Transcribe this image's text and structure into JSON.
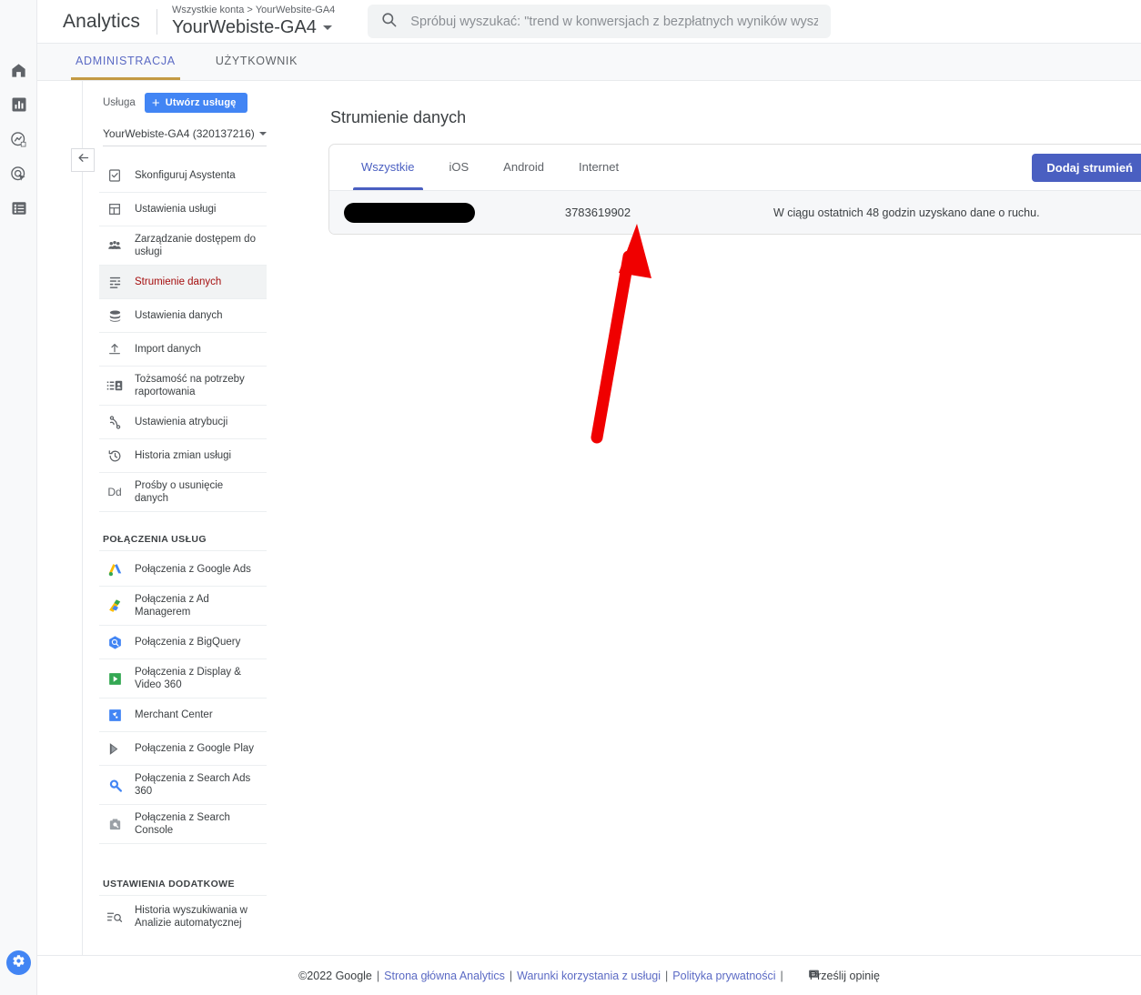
{
  "brand": {
    "name": "Analytics",
    "logo_icon": "analytics-bars-logo"
  },
  "account": {
    "breadcrumb_root": "Wszystkie konta",
    "breadcrumb_sep": ">",
    "breadcrumb_current": "YourWebsite-GA4",
    "property_name": "YourWebiste-GA4"
  },
  "search": {
    "placeholder": "Spróbuj wyszukać: \"trend w konwersjach z bezpłatnych wyników wyszuki…",
    "icon": "search-icon"
  },
  "rail": {
    "items": [
      {
        "name": "home",
        "icon": "home-icon"
      },
      {
        "name": "reports",
        "icon": "bar-chart-icon"
      },
      {
        "name": "explore",
        "icon": "explore-compass-icon"
      },
      {
        "name": "advertising",
        "icon": "advertising-target-icon"
      },
      {
        "name": "library",
        "icon": "library-list-icon"
      }
    ],
    "admin_icon": "gear-icon"
  },
  "tabs": [
    {
      "label": "ADMINISTRACJA",
      "active": true
    },
    {
      "label": "UŻYTKOWNIK",
      "active": false
    }
  ],
  "back_button": {
    "icon": "arrow-left-icon"
  },
  "sidebar": {
    "property_label": "Usługa",
    "create_button": {
      "label": "Utwórz usługę",
      "icon": "plus-icon"
    },
    "property_selector": {
      "value": "YourWebiste-GA4 (320137216)",
      "icon": "chevron-down-icon"
    },
    "items": [
      {
        "label": "Skonfiguruj Asystenta",
        "icon": "checklist-icon",
        "selected": false
      },
      {
        "label": "Ustawienia usługi",
        "icon": "property-settings-icon",
        "selected": false
      },
      {
        "label": "Zarządzanie dostępem do usługi",
        "icon": "people-icon",
        "selected": false
      },
      {
        "label": "Strumienie danych",
        "icon": "data-streams-icon",
        "selected": true
      },
      {
        "label": "Ustawienia danych",
        "icon": "database-icon",
        "selected": false
      },
      {
        "label": "Import danych",
        "icon": "upload-icon",
        "selected": false
      },
      {
        "label": "Tożsamość na potrzeby raportowania",
        "icon": "reporting-identity-icon",
        "selected": false
      },
      {
        "label": "Ustawienia atrybucji",
        "icon": "attribution-icon",
        "selected": false
      },
      {
        "label": "Historia zmian usługi",
        "icon": "history-clock-icon",
        "selected": false
      },
      {
        "label": "Prośby o usunięcie danych",
        "icon": "dd-text-icon",
        "selected": false
      }
    ],
    "section_links_title": "POŁĄCZENIA USŁUG",
    "link_items": [
      {
        "label": "Połączenia z Google Ads",
        "icon": "google-ads-icon"
      },
      {
        "label": "Połączenia z Ad Managerem",
        "icon": "ad-manager-icon"
      },
      {
        "label": "Połączenia z BigQuery",
        "icon": "bigquery-icon"
      },
      {
        "label": "Połączenia z Display & Video 360",
        "icon": "display-video-360-icon"
      },
      {
        "label": "Merchant Center",
        "icon": "merchant-center-icon"
      },
      {
        "label": "Połączenia z Google Play",
        "icon": "google-play-icon"
      },
      {
        "label": "Połączenia z Search Ads 360",
        "icon": "search-ads-360-icon"
      },
      {
        "label": "Połączenia z Search Console",
        "icon": "search-console-icon"
      }
    ],
    "section_extra_title": "USTAWIENIA DODATKOWE",
    "extra_items": [
      {
        "label": "Historia wyszukiwania w Analizie automatycznej",
        "icon": "search-history-icon"
      }
    ]
  },
  "main": {
    "page_title": "Strumienie danych",
    "card_tabs": [
      {
        "label": "Wszystkie",
        "active": true
      },
      {
        "label": "iOS",
        "active": false
      },
      {
        "label": "Android",
        "active": false
      },
      {
        "label": "Internet",
        "active": false
      }
    ],
    "add_stream_button": {
      "label": "Dodaj strumień",
      "icon": "chevron-down-icon"
    },
    "stream_row": {
      "name_redacted": true,
      "stream_id": "3783619902",
      "status": "W ciągu ostatnich 48 godzin uzyskano dane o ruchu.",
      "chevron_icon": "chevron-right-icon"
    }
  },
  "annotation": {
    "type": "red-arrow",
    "color": "#f00000"
  },
  "footer": {
    "copyright": "©2022 Google",
    "links": [
      "Strona główna Analytics",
      "Warunki korzystania z usługi",
      "Polityka prywatności"
    ],
    "feedback_label": "Prześlij opinię",
    "feedback_icon": "feedback-icon"
  },
  "colors": {
    "accent_blue": "#4a5fc1",
    "brand_orange": "#f9ab00",
    "selected_red": "#a50e0e",
    "tab_underline": "#c49a43",
    "annotation_red": "#f00000"
  }
}
